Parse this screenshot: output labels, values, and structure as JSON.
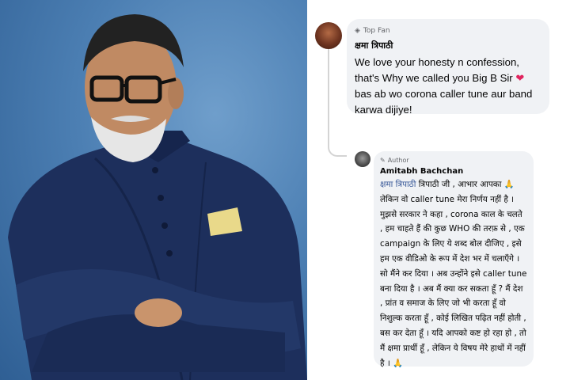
{
  "photo": {
    "description_icon": "person-photo",
    "pocket_square_color": "#e9d98a",
    "suit_color": "#1d2f5c"
  },
  "top_comment": {
    "badge": "Top Fan",
    "badge_icon": "diamond-icon",
    "author": "क्षमा त्रिपाठी",
    "text_before_heart": "We love your honesty n confession, that's Why we called you Big B Sir",
    "heart": "❤",
    "text_after_heart": " bas ab wo corona caller tune aur band karwa dijiye!"
  },
  "reply": {
    "badge": "Author",
    "badge_icon": "pencil-icon",
    "author": "Amitabh Bachchan",
    "mention": "क्षमा त्रिपाठी",
    "text": " त्रिपाठी जी , आभार आपका 🙏 लेकिन वो caller tune मेरा निर्णय नहीं है । मुझसे सरकार ने कहा , corona काल के चलते , हम चाहते हैं की कुछ WHO की तरफ़ से , एक campaign के लिए ये शब्द बोल दीजिए , इसे हम एक वीडिओ के रूप में देश भर में चलाएँगे । सो मैंने कर दिया । अब उन्होंने इसे caller tune बना दिया है । अब मैं क्या कर सकता हूँ ? मैं देश , प्रांत व समाज के लिए जो भी करता हूँ वो निशुल्क करता हूँ , कोई लिखित पढ़ित नहीं होती , बस कर देता हूँ । यदि आपको कष्ट हो रहा हो , तो मैं क्षमा प्रार्थी हूँ , लेकिन ये विषय मेरे हाथों में नहीं है । 🙏"
  }
}
